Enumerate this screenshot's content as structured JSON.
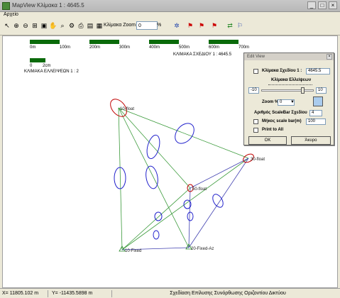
{
  "window": {
    "title": "MapView  Κλίμακα 1 : 4645.5"
  },
  "menu": {
    "items": [
      "Αρχείο"
    ]
  },
  "toolbar": {
    "zoom_label": "Κλίμακα Zoom",
    "zoom_value": "0",
    "zoom_unit": "%"
  },
  "scalebars": {
    "drawing_ticks": [
      "0m",
      "100m",
      "200m",
      "300m",
      "400m",
      "500m",
      "600m",
      "700m"
    ],
    "drawing_scale_label": "ΚΛΙΜΑΚΑ ΣΧΕΔΙΟΥ 1 : 4645.5",
    "ellipse_ticks": [
      "0",
      "2cm"
    ],
    "ellipse_scale_label": "ΚΛΙΜΑΚΑ ΕΛΛΕΙΨΕΩΝ 1 : 2"
  },
  "points": {
    "p1": "10-float",
    "p2": "30-float",
    "p3": "50-float",
    "p4": "10-Fixed",
    "p5": "20-Fixed-Az"
  },
  "dialog": {
    "title": "Edit View",
    "drawing_scale_label": "Κλίμακα Σχεδίου 1 :",
    "drawing_scale_value": "4645.5",
    "ellipse_scale_label": "Κλίμακα Ελλείψεων",
    "slider_min": "-10",
    "slider_max": "10",
    "slider_level_fraction": 0.78,
    "zoom_label": "Zoom %",
    "zoom_value": "0",
    "scalebar_count_label": "Αριθμός ScaleBar Σχεδίου",
    "scalebar_count_value": "4",
    "scalebar_length_label": "Μήκος scale bar(m)",
    "scalebar_length_value": "100",
    "print_all_label": "Print to All",
    "ok_label": "OK",
    "cancel_label": "Άκυρο"
  },
  "status": {
    "x": "X= 11805.102  m",
    "y": "Y= -11435.5898  m",
    "description": "Σχεδίαση Επίλυσης Συνόρθωσης Οριζοντίου Δικτύου"
  },
  "colors": {
    "network_green": "#3a9a3a",
    "network_blue": "#4040b0",
    "ellipse_blue": "#2222cc",
    "error_red": "#c00000",
    "scalebar_green": "#0a6a0a"
  }
}
